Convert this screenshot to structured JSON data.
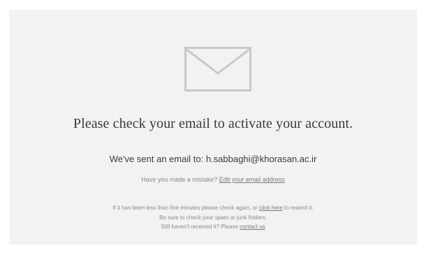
{
  "icon": "envelope-icon",
  "headline": "Please check your email to activate your account.",
  "sent": {
    "prefix": "We've sent an email to:",
    "email": "h.sabbaghi@khorasan.ac.ir"
  },
  "mistake": {
    "question": "Have you made a mistake?",
    "edit_link": "Edit your email address"
  },
  "help": {
    "line1_prefix": "If it has been less than five minutes please check again, or",
    "resend_link": "click here",
    "line1_suffix": "to resend it.",
    "line2": "Be sure to check your spam or junk folders.",
    "line3_prefix": "Still haven't received it? Please",
    "contact_link": "contact us"
  },
  "colors": {
    "card_background": "#f2f2f1",
    "icon_stroke": "#c9c9c7",
    "text_dark": "#3a3a3a",
    "text_muted": "#8a8a8a"
  }
}
